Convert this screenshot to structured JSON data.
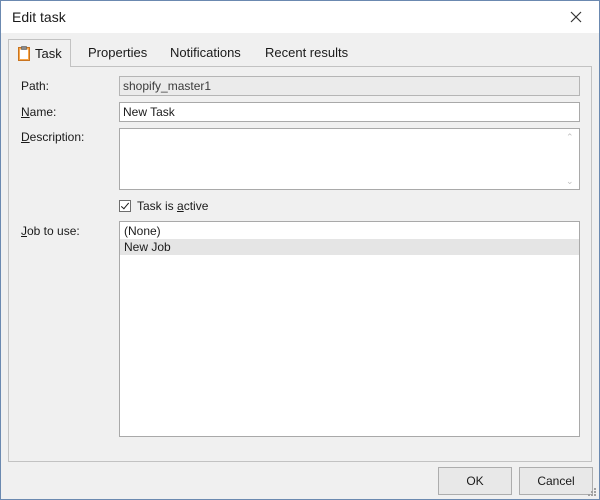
{
  "window": {
    "title": "Edit task"
  },
  "tabs": [
    {
      "label": "Task",
      "active": true,
      "icon": "clipboard-icon"
    },
    {
      "label": "Properties",
      "active": false
    },
    {
      "label": "Notifications",
      "active": false
    },
    {
      "label": "Recent results",
      "active": false
    }
  ],
  "form": {
    "path_label": "Path:",
    "path_value": "shopify_master1",
    "name_label_key": "N",
    "name_label_rest": "ame:",
    "name_value": "New Task",
    "description_label_key": "D",
    "description_label_rest": "escription:",
    "description_value": "",
    "active_label_pre": "Task is ",
    "active_label_key": "a",
    "active_label_rest": "ctive",
    "active_checked": true,
    "job_label_key": "J",
    "job_label_rest": "ob to use:",
    "job_options": [
      "(None)",
      "New Job"
    ],
    "job_selected": "New Job"
  },
  "buttons": {
    "ok": "OK",
    "cancel": "Cancel"
  },
  "colors": {
    "border_accent": "#6b89b0",
    "selection": "#e5e5e5",
    "background": "#f0f0f0"
  }
}
